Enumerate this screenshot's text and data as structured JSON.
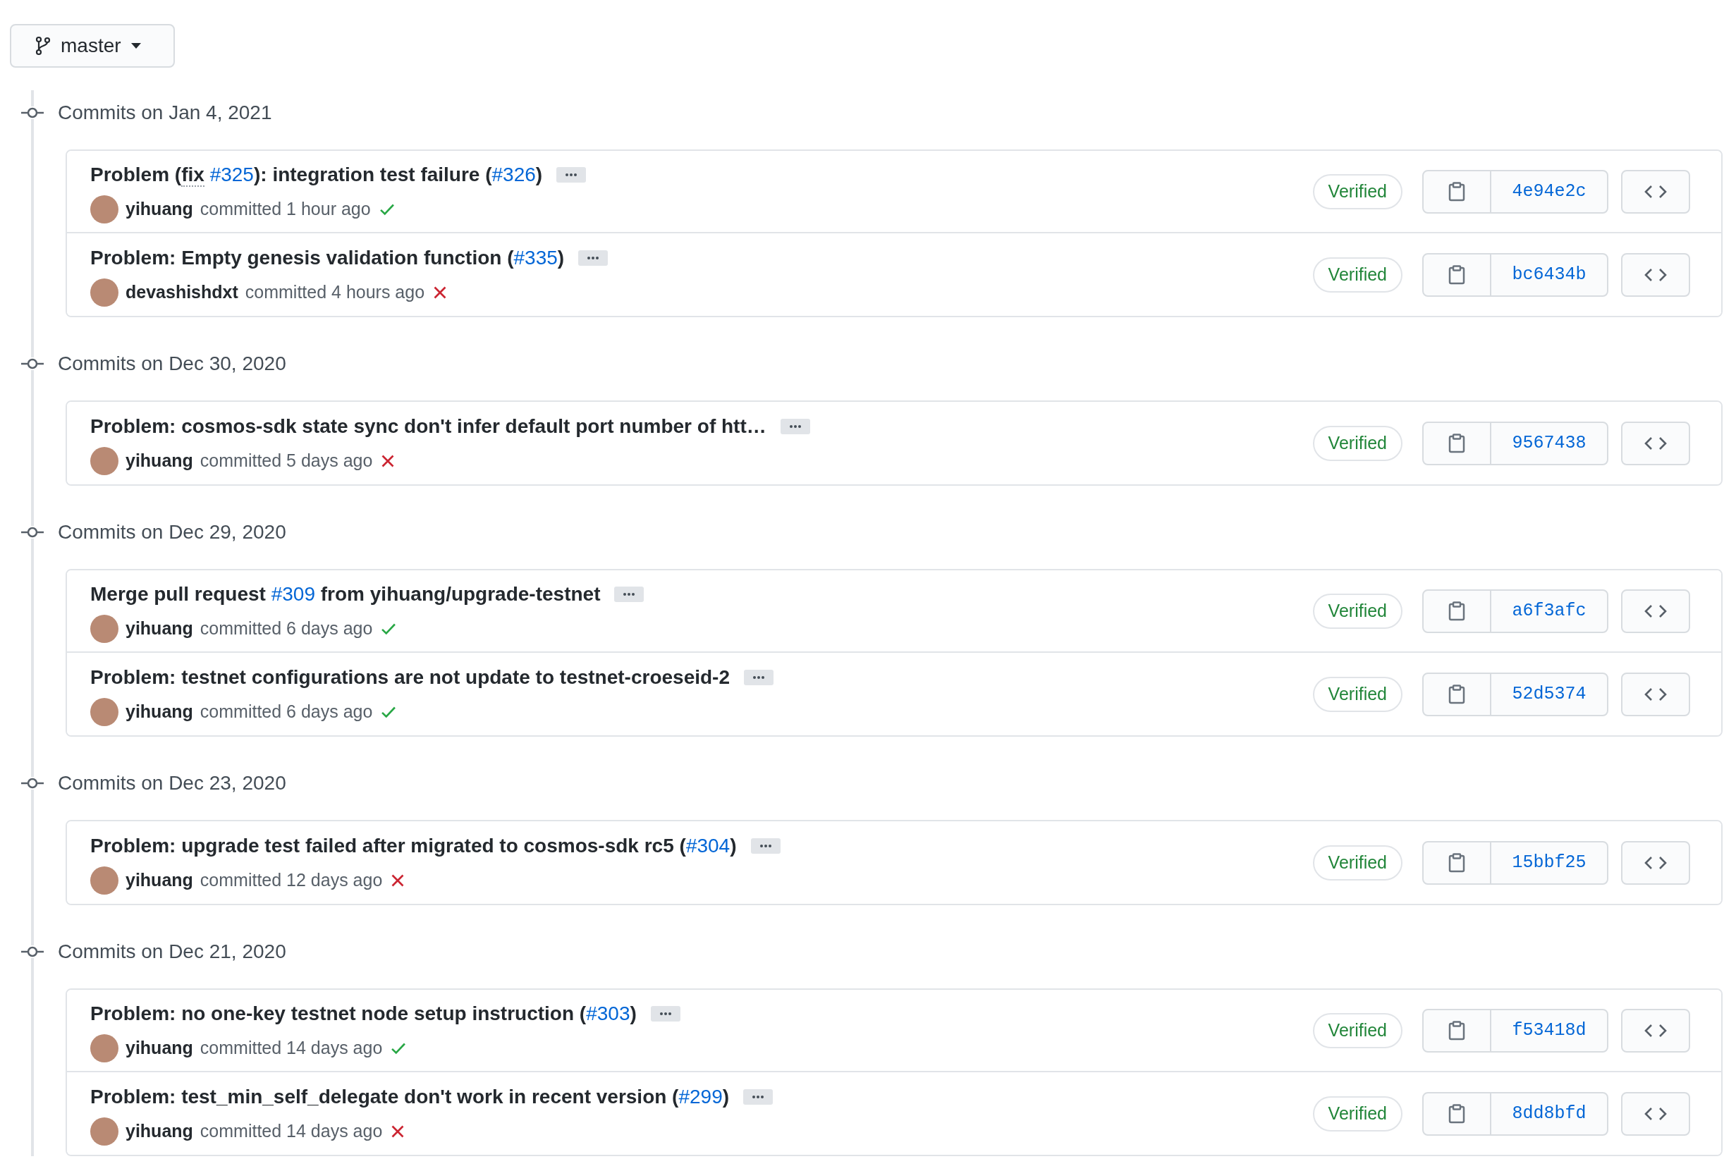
{
  "branch": {
    "label": "master"
  },
  "groups": [
    {
      "date": "Commits on Jan 4, 2021",
      "commits": [
        {
          "title": [
            {
              "kind": "text",
              "text": "Problem ("
            },
            {
              "kind": "abbr",
              "text": "fix"
            },
            {
              "kind": "link",
              "text": "#325"
            },
            {
              "kind": "text",
              "text": "): integration test failure ("
            },
            {
              "kind": "link",
              "text": "#326"
            },
            {
              "kind": "text",
              "text": ")"
            }
          ],
          "author": "yihuang",
          "when": "committed 1 hour ago",
          "ci_passed": true,
          "badge": "Verified",
          "sha": "4e94e2c"
        },
        {
          "title": [
            {
              "kind": "text",
              "text": "Problem: Empty genesis validation function ("
            },
            {
              "kind": "link",
              "text": "#335"
            },
            {
              "kind": "text",
              "text": ")"
            }
          ],
          "author": "devashishdxt",
          "when": "committed 4 hours ago",
          "ci_passed": false,
          "badge": "Verified",
          "sha": "bc6434b"
        }
      ]
    },
    {
      "date": "Commits on Dec 30, 2020",
      "commits": [
        {
          "title": [
            {
              "kind": "text",
              "text": "Problem: cosmos-sdk state sync don't infer default port number of htt…"
            }
          ],
          "author": "yihuang",
          "when": "committed 5 days ago",
          "ci_passed": false,
          "badge": "Verified",
          "sha": "9567438"
        }
      ]
    },
    {
      "date": "Commits on Dec 29, 2020",
      "commits": [
        {
          "title": [
            {
              "kind": "text",
              "text": "Merge pull request "
            },
            {
              "kind": "link",
              "text": "#309"
            },
            {
              "kind": "text",
              "text": " from yihuang/upgrade-testnet"
            }
          ],
          "author": "yihuang",
          "when": "committed 6 days ago",
          "ci_passed": true,
          "badge": "Verified",
          "sha": "a6f3afc"
        },
        {
          "title": [
            {
              "kind": "text",
              "text": "Problem: testnet configurations are not update to testnet-croeseid-2"
            }
          ],
          "author": "yihuang",
          "when": "committed 6 days ago",
          "ci_passed": true,
          "badge": "Verified",
          "sha": "52d5374"
        }
      ]
    },
    {
      "date": "Commits on Dec 23, 2020",
      "commits": [
        {
          "title": [
            {
              "kind": "text",
              "text": "Problem: upgrade test failed after migrated to cosmos-sdk rc5 ("
            },
            {
              "kind": "link",
              "text": "#304"
            },
            {
              "kind": "text",
              "text": ")"
            }
          ],
          "author": "yihuang",
          "when": "committed 12 days ago",
          "ci_passed": false,
          "badge": "Verified",
          "sha": "15bbf25"
        }
      ]
    },
    {
      "date": "Commits on Dec 21, 2020",
      "commits": [
        {
          "title": [
            {
              "kind": "text",
              "text": "Problem: no one-key testnet node setup instruction ("
            },
            {
              "kind": "link",
              "text": "#303"
            },
            {
              "kind": "text",
              "text": ")"
            }
          ],
          "author": "yihuang",
          "when": "committed 14 days ago",
          "ci_passed": true,
          "badge": "Verified",
          "sha": "f53418d"
        },
        {
          "title": [
            {
              "kind": "text",
              "text": "Problem: test_min_self_delegate don't work in recent version ("
            },
            {
              "kind": "link",
              "text": "#299"
            },
            {
              "kind": "text",
              "text": ")"
            }
          ],
          "author": "yihuang",
          "when": "committed 14 days ago",
          "ci_passed": false,
          "badge": "Verified",
          "sha": "8dd8bfd"
        }
      ]
    }
  ]
}
